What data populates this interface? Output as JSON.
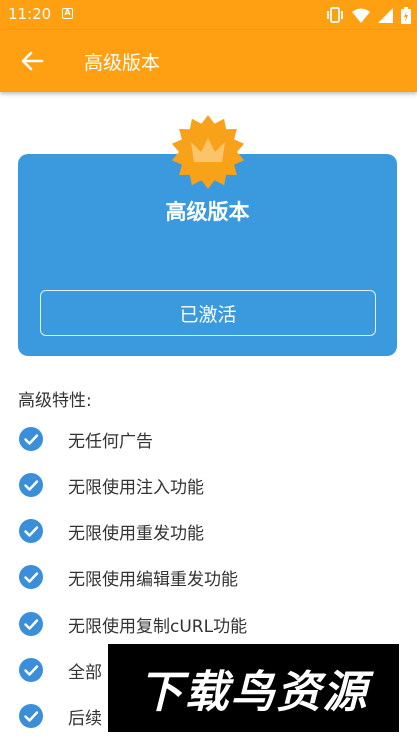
{
  "status_bar": {
    "time": "11:20",
    "notification_letter": "A"
  },
  "toolbar": {
    "title": "高级版本"
  },
  "card": {
    "title": "高级版本",
    "activated_label": "已激活"
  },
  "features": {
    "heading": "高级特性:",
    "items": [
      {
        "label": "无任何广告"
      },
      {
        "label": "无限使用注入功能"
      },
      {
        "label": "无限使用重发功能"
      },
      {
        "label": "无限使用编辑重发功能"
      },
      {
        "label": "无限使用复制cURL功能"
      },
      {
        "label": "全部"
      },
      {
        "label": "后续"
      }
    ]
  },
  "watermark": {
    "text": "下载鸟资源"
  },
  "colors": {
    "accent": "#ff9f12",
    "card_blue": "#3b9ade",
    "check_blue": "#3b8fd9",
    "badge_orange": "#f8a21a"
  }
}
